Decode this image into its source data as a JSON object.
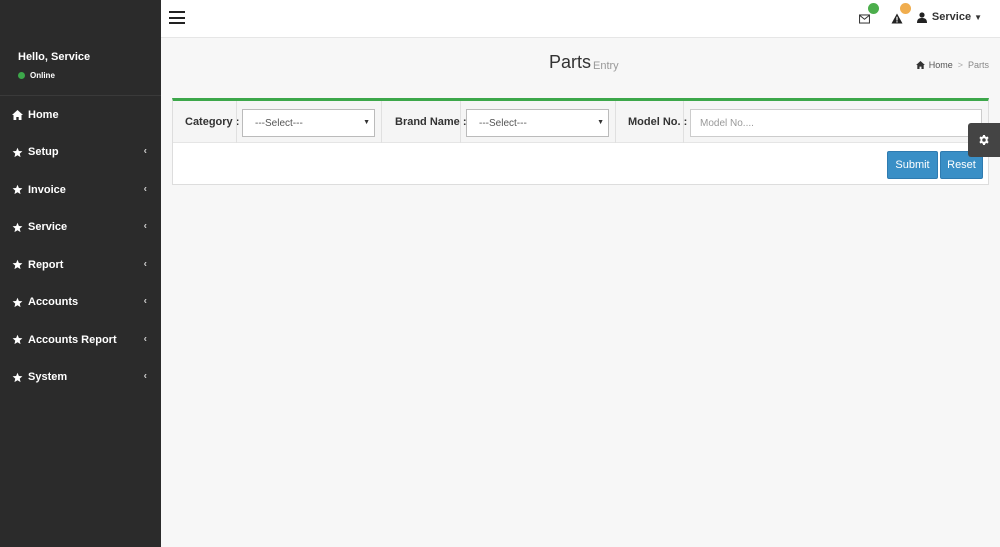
{
  "sidebar": {
    "greeting": "Hello, Service",
    "status": "Online",
    "items": [
      {
        "label": "Home",
        "has_chevron": false
      },
      {
        "label": "Setup",
        "has_chevron": true
      },
      {
        "label": "Invoice",
        "has_chevron": true
      },
      {
        "label": "Service",
        "has_chevron": true
      },
      {
        "label": "Report",
        "has_chevron": true
      },
      {
        "label": "Accounts",
        "has_chevron": true
      },
      {
        "label": "Accounts Report",
        "has_chevron": true
      },
      {
        "label": "System",
        "has_chevron": true
      }
    ]
  },
  "header": {
    "user_label": "Service",
    "mail_badge_color": "#4cae4c",
    "alert_badge_color": "#f0ad4e"
  },
  "page": {
    "title": "Parts",
    "subtitle": "Entry"
  },
  "breadcrumb": {
    "home": "Home",
    "current": "Parts"
  },
  "form": {
    "category_label": "Category :",
    "category_value": "---Select---",
    "brand_label": "Brand Name :",
    "brand_value": "---Select---",
    "model_label": "Model No. :",
    "model_placeholder": "Model No....",
    "submit_label": "Submit",
    "reset_label": "Reset"
  },
  "colors": {
    "accent": "#3ca74a",
    "primary_button": "#3a8fc6",
    "sidebar_bg": "#2b2b2b"
  }
}
